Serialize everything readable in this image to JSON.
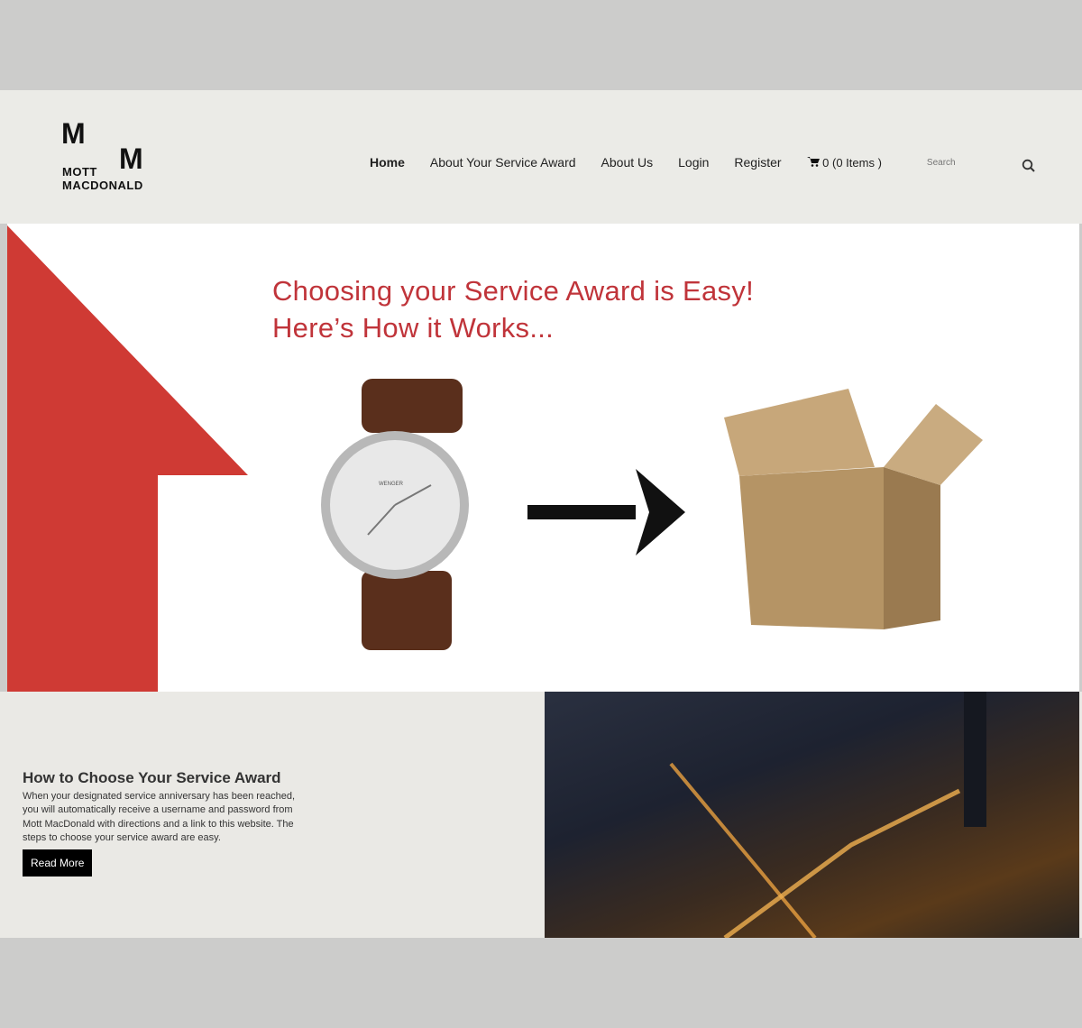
{
  "logo": {
    "letters": [
      "M",
      "M"
    ],
    "words": [
      "MOTT",
      "MACDONALD"
    ]
  },
  "nav": {
    "items": [
      "Home",
      "About Your Service Award",
      "About Us",
      "Login",
      "Register"
    ],
    "cart": "0 (0 Items )",
    "search_placeholder": "Search"
  },
  "hero": {
    "line1": "Choosing your Service Award is Easy!",
    "line2": "Here’s How it Works...",
    "watch_brand": "WENGER",
    "accent": "#cf3a34"
  },
  "article": {
    "title": "How to Choose Your Service Award",
    "body": "When your designated service anniversary has been reached, you will automatically receive a username and password from Mott MacDonald with directions and a link to this website. The steps to choose your service award are easy.",
    "button": "Read More"
  }
}
